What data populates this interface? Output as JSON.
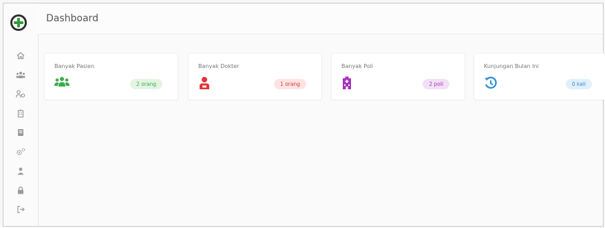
{
  "header": {
    "title": "Dashboard"
  },
  "sidebar": {
    "items": [
      {
        "icon": "home-icon"
      },
      {
        "icon": "users-icon"
      },
      {
        "icon": "doctor-icon"
      },
      {
        "icon": "building-icon"
      },
      {
        "icon": "book-icon"
      },
      {
        "icon": "gears-icon"
      },
      {
        "icon": "user-icon"
      },
      {
        "icon": "lock-icon"
      },
      {
        "icon": "logout-icon"
      }
    ]
  },
  "cards": [
    {
      "label": "Banyak Pasien",
      "value": "2 orang",
      "icon": "users-icon",
      "color": "#3cab4a",
      "badge_bg": "#e3f4e4"
    },
    {
      "label": "Banyak Dokter",
      "value": "1 orang",
      "icon": "doctor-icon",
      "color": "#e2333a",
      "badge_bg": "#fde4e4"
    },
    {
      "label": "Banyak Poli",
      "value": "2 poli",
      "icon": "hospital-icon",
      "color": "#a633b8",
      "badge_bg": "#f1e0f6"
    },
    {
      "label": "Kunjungan Bulan Ini",
      "value": "0 kali",
      "icon": "history-icon",
      "color": "#2d8fd6",
      "badge_bg": "#e2f0fb"
    }
  ]
}
